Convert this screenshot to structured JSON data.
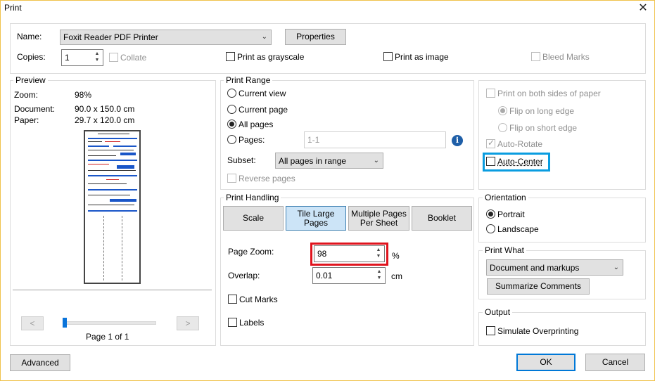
{
  "window": {
    "title": "Print",
    "close_glyph": "✕"
  },
  "printer": {
    "name_label": "Name:",
    "name_value": "Foxit Reader PDF Printer",
    "properties_label": "Properties",
    "copies_label": "Copies:",
    "copies_value": "1",
    "collate_label": "Collate",
    "grayscale_label": "Print as grayscale",
    "image_label": "Print as image",
    "bleed_label": "Bleed Marks"
  },
  "preview": {
    "legend": "Preview",
    "zoom_label": "Zoom:",
    "zoom_value": "98%",
    "document_label": "Document:",
    "document_value": "90.0 x 150.0 cm",
    "paper_label": "Paper:",
    "paper_value": "29.7 x 120.0 cm",
    "prev_glyph": "<",
    "next_glyph": ">",
    "page_indicator": "Page 1 of 1"
  },
  "print_range": {
    "legend": "Print Range",
    "current_view": "Current view",
    "current_page": "Current page",
    "all_pages": "All pages",
    "pages_label": "Pages:",
    "pages_value": "1-1",
    "subset_label": "Subset:",
    "subset_value": "All pages in range",
    "reverse_label": "Reverse pages"
  },
  "print_handling": {
    "legend": "Print Handling",
    "tabs": [
      "Scale",
      "Tile Large Pages",
      "Multiple Pages Per Sheet",
      "Booklet"
    ],
    "page_zoom_label": "Page Zoom:",
    "page_zoom_value": "98",
    "page_zoom_unit": "%",
    "overlap_label": "Overlap:",
    "overlap_value": "0.01",
    "overlap_unit": "cm",
    "cut_marks_label": "Cut Marks",
    "labels_label": "Labels"
  },
  "duplex": {
    "both_sides_label": "Print on both sides of paper",
    "flip_long_label": "Flip on long edge",
    "flip_short_label": "Flip on short edge",
    "auto_rotate_label": "Auto-Rotate",
    "auto_center_label": "Auto-Center"
  },
  "orientation": {
    "legend": "Orientation",
    "portrait": "Portrait",
    "landscape": "Landscape"
  },
  "print_what": {
    "legend": "Print What",
    "value": "Document and markups",
    "summarize_label": "Summarize Comments"
  },
  "output": {
    "legend": "Output",
    "simulate_label": "Simulate Overprinting"
  },
  "footer": {
    "advanced_label": "Advanced",
    "ok_label": "OK",
    "cancel_label": "Cancel"
  },
  "colors": {
    "highlight_red": "#e0141e",
    "highlight_blue": "#0a9de0",
    "selected_tab": "#cce4f7",
    "slider": "#0a74da"
  }
}
